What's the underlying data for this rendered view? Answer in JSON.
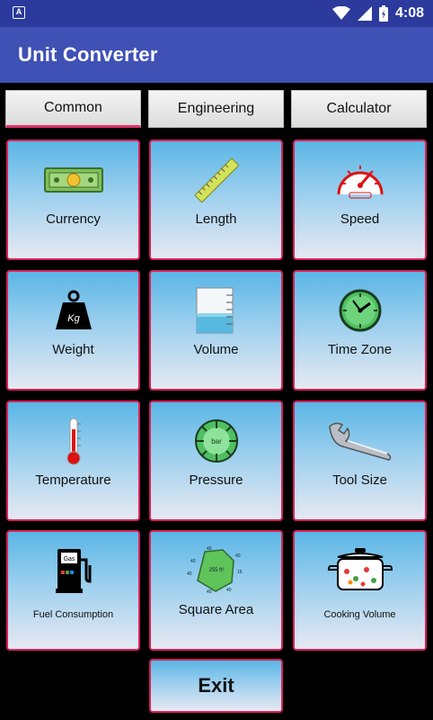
{
  "status": {
    "time": "4:08",
    "notif_letter": "A"
  },
  "app": {
    "title": "Unit Converter"
  },
  "tabs": [
    {
      "label": "Common",
      "active": true
    },
    {
      "label": "Engineering",
      "active": false
    },
    {
      "label": "Calculator",
      "active": false
    }
  ],
  "tiles": [
    {
      "label": "Currency",
      "icon": "currency-icon"
    },
    {
      "label": "Length",
      "icon": "ruler-icon"
    },
    {
      "label": "Speed",
      "icon": "speedometer-icon"
    },
    {
      "label": "Weight",
      "icon": "weight-icon"
    },
    {
      "label": "Volume",
      "icon": "beaker-icon"
    },
    {
      "label": "Time Zone",
      "icon": "clock-icon"
    },
    {
      "label": "Temperature",
      "icon": "thermometer-icon"
    },
    {
      "label": "Pressure",
      "icon": "pressure-gauge-icon"
    },
    {
      "label": "Tool Size",
      "icon": "wrench-icon"
    },
    {
      "label": "Fuel Consumption",
      "icon": "fuel-pump-icon"
    },
    {
      "label": "Square Area",
      "icon": "area-plot-icon"
    },
    {
      "label": "Cooking Volume",
      "icon": "cooking-pot-icon"
    }
  ],
  "icon_text": {
    "weight_kg": "Kg",
    "gas": "Gas",
    "pressure_unit": "bar",
    "area_value": "255 ft²"
  },
  "exit_label": "Exit",
  "colors": {
    "appbar": "#3f51b5",
    "statusbar": "#2b3a9c",
    "tile_border": "#d9215a",
    "tab_indicator": "#e0356a"
  }
}
